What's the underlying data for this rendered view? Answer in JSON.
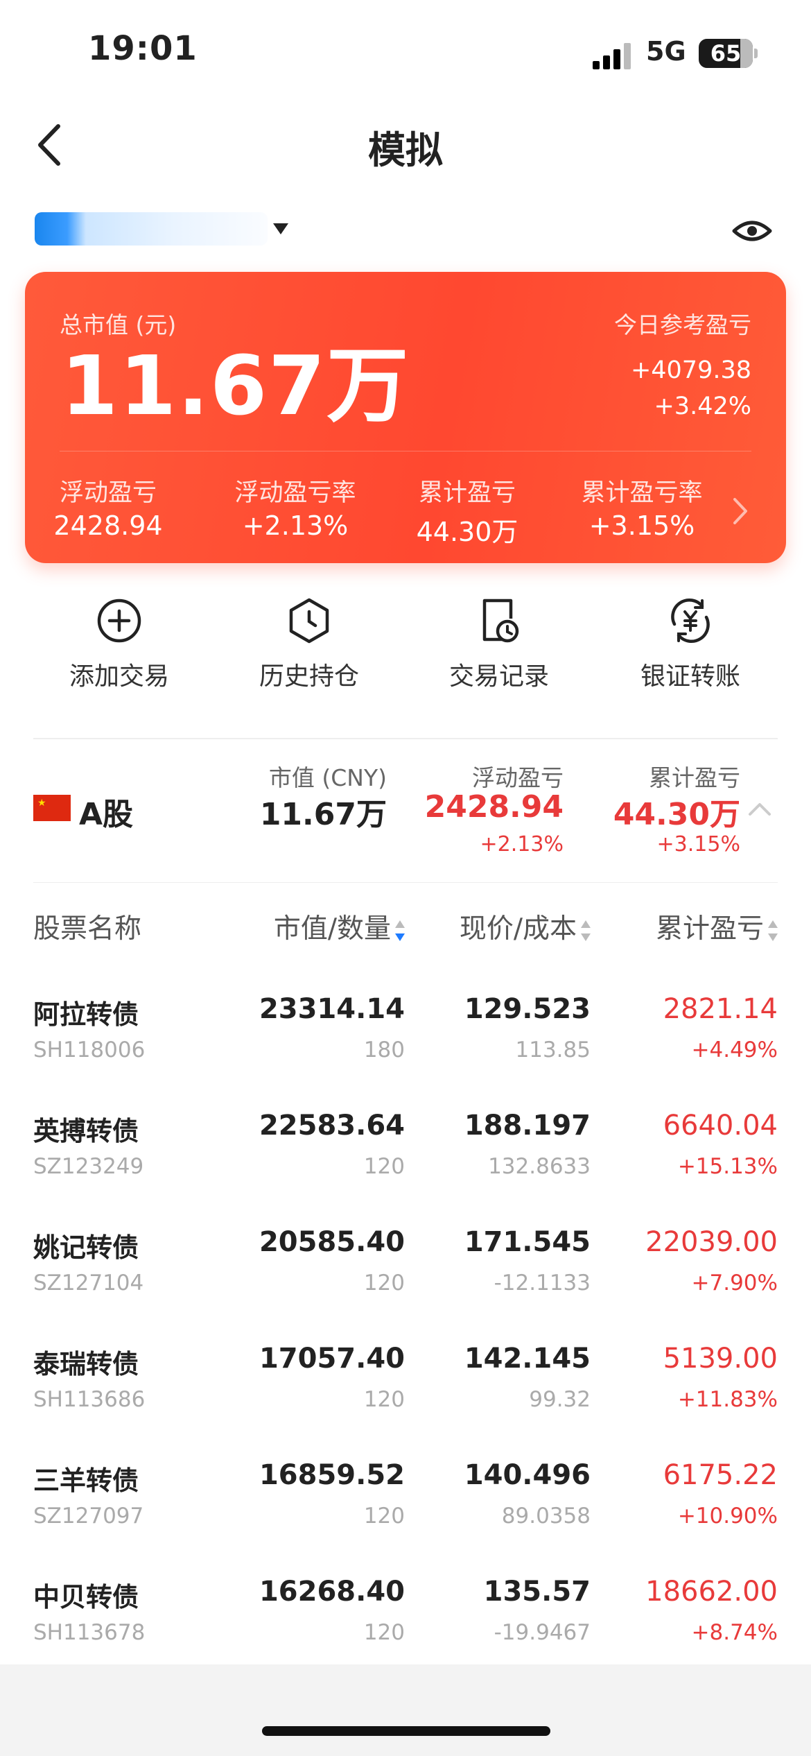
{
  "status_bar": {
    "time": "19:01",
    "network": "5G",
    "battery": "65"
  },
  "nav": {
    "title": "模拟"
  },
  "summary": {
    "total_label": "总市值 (元)",
    "total_value": "11.67万",
    "today_label": "今日参考盈亏",
    "today_amount": "+4079.38",
    "today_pct": "+3.42%",
    "stats": [
      {
        "label": "浮动盈亏",
        "value": "2428.94"
      },
      {
        "label": "浮动盈亏率",
        "value": "+2.13%"
      },
      {
        "label": "累计盈亏",
        "value": "44.30万"
      },
      {
        "label": "累计盈亏率",
        "value": "+3.15%"
      }
    ]
  },
  "actions": [
    {
      "label": "添加交易",
      "icon": "plus-circle-icon"
    },
    {
      "label": "历史持仓",
      "icon": "clock-shield-icon"
    },
    {
      "label": "交易记录",
      "icon": "doc-clock-icon"
    },
    {
      "label": "银证转账",
      "icon": "yuan-transfer-icon"
    }
  ],
  "market": {
    "name": "A股",
    "mv_label": "市值 (CNY)",
    "mv_value": "11.67万",
    "float_label": "浮动盈亏",
    "float_value": "2428.94",
    "float_pct": "+2.13%",
    "cum_label": "累计盈亏",
    "cum_value": "44.30万",
    "cum_pct": "+3.15%"
  },
  "table": {
    "headers": [
      "股票名称",
      "市值/数量",
      "现价/成本",
      "累计盈亏"
    ],
    "rows": [
      {
        "name": "阿拉转债",
        "code": "SH118006",
        "mv": "23314.14",
        "qty": "180",
        "price": "129.523",
        "cost": "113.85",
        "pl": "2821.14",
        "pct": "+4.49%"
      },
      {
        "name": "英搏转债",
        "code": "SZ123249",
        "mv": "22583.64",
        "qty": "120",
        "price": "188.197",
        "cost": "132.8633",
        "pl": "6640.04",
        "pct": "+15.13%"
      },
      {
        "name": "姚记转债",
        "code": "SZ127104",
        "mv": "20585.40",
        "qty": "120",
        "price": "171.545",
        "cost": "-12.1133",
        "pl": "22039.00",
        "pct": "+7.90%"
      },
      {
        "name": "泰瑞转债",
        "code": "SH113686",
        "mv": "17057.40",
        "qty": "120",
        "price": "142.145",
        "cost": "99.32",
        "pl": "5139.00",
        "pct": "+11.83%"
      },
      {
        "name": "三羊转债",
        "code": "SZ127097",
        "mv": "16859.52",
        "qty": "120",
        "price": "140.496",
        "cost": "89.0358",
        "pl": "6175.22",
        "pct": "+10.90%"
      },
      {
        "name": "中贝转债",
        "code": "SH113678",
        "mv": "16268.40",
        "qty": "120",
        "price": "135.57",
        "cost": "-19.9467",
        "pl": "18662.00",
        "pct": "+8.74%"
      }
    ]
  },
  "colors": {
    "accent": "#ff4d2e",
    "gain": "#e83a3a",
    "sort_active": "#1e7bff"
  }
}
